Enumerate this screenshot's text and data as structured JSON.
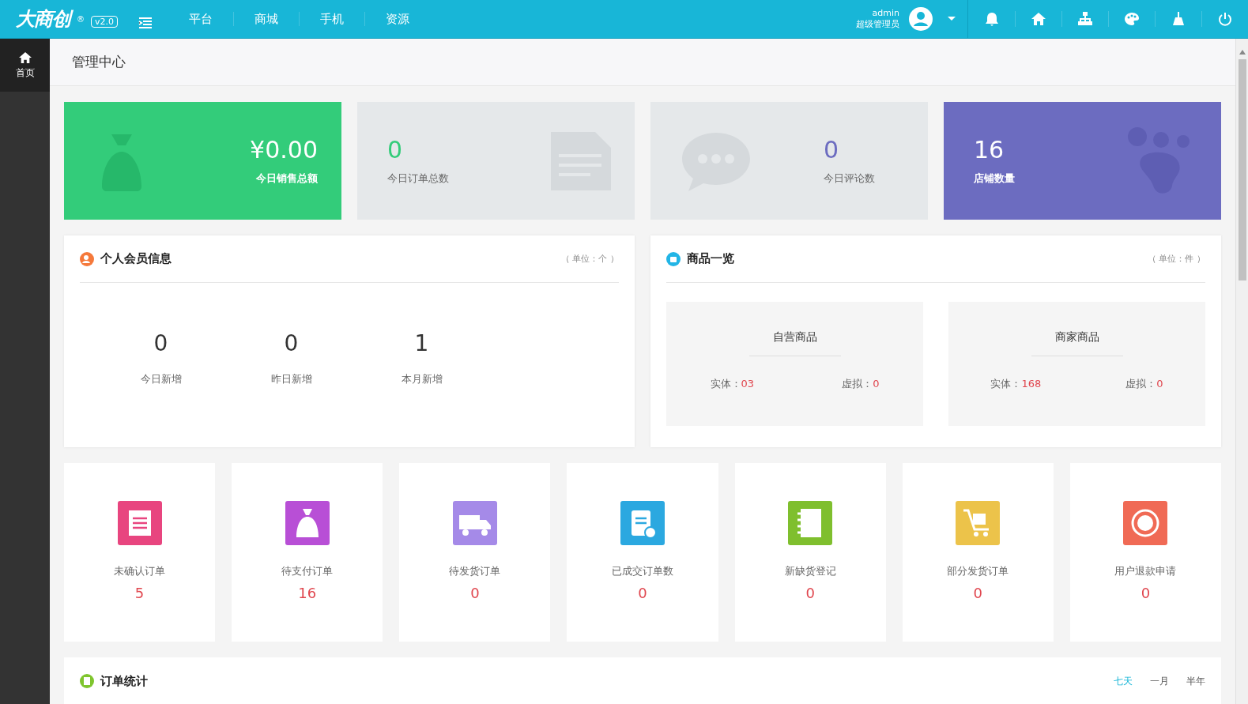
{
  "brand": {
    "logo": "大商创",
    "registered": "®",
    "version": "v2.0"
  },
  "nav": [
    {
      "label": "平台"
    },
    {
      "label": "商城"
    },
    {
      "label": "手机"
    },
    {
      "label": "资源"
    }
  ],
  "user": {
    "name": "admin",
    "role": "超级管理员"
  },
  "sidebar": {
    "items": [
      {
        "label": "首页",
        "selected": true
      }
    ]
  },
  "page_title": "管理中心",
  "stats": [
    {
      "kind": "money",
      "value": "¥0.00",
      "label": "今日销售总额"
    },
    {
      "kind": "document",
      "value": "0",
      "label": "今日订单总数"
    },
    {
      "kind": "chat",
      "value": "0",
      "label": "今日评论数"
    },
    {
      "kind": "paw",
      "value": "16",
      "label": "店铺数量"
    }
  ],
  "members": {
    "title": "个人会员信息",
    "unit": "（ 单位：个 ）",
    "items": [
      {
        "value": "0",
        "label": "今日新增"
      },
      {
        "value": "0",
        "label": "昨日新增"
      },
      {
        "value": "1",
        "label": "本月新增"
      }
    ]
  },
  "goods": {
    "title": "商品一览",
    "unit": "（ 单位：件 ）",
    "groups": [
      {
        "title": "自营商品",
        "entries": [
          {
            "label": "实体：",
            "value": "03"
          },
          {
            "label": "虚拟：",
            "value": "0"
          }
        ]
      },
      {
        "title": "商家商品",
        "entries": [
          {
            "label": "实体：",
            "value": "168"
          },
          {
            "label": "虚拟：",
            "value": "0"
          }
        ]
      }
    ]
  },
  "orders": [
    {
      "kind": "list",
      "label": "未确认订单",
      "value": "5",
      "color": "#e8457f"
    },
    {
      "kind": "bag",
      "label": "待支付订单",
      "value": "16",
      "color": "#b84fd6"
    },
    {
      "kind": "truck",
      "label": "待发货订单",
      "value": "0",
      "color": "#a58ae8"
    },
    {
      "kind": "clipboard",
      "label": "已成交订单数",
      "value": "0",
      "color": "#2ba8e0"
    },
    {
      "kind": "notebook",
      "label": "新缺货登记",
      "value": "0",
      "color": "#7fbf2e"
    },
    {
      "kind": "cart",
      "label": "部分发货订单",
      "value": "0",
      "color": "#ecc34a"
    },
    {
      "kind": "refund",
      "label": "用户退款申请",
      "value": "0",
      "color": "#f06a55"
    }
  ],
  "order_stats": {
    "title": "订单统计",
    "tabs": [
      {
        "label": "七天",
        "selected": true
      },
      {
        "label": "一月",
        "selected": false
      },
      {
        "label": "半年",
        "selected": false
      }
    ]
  }
}
